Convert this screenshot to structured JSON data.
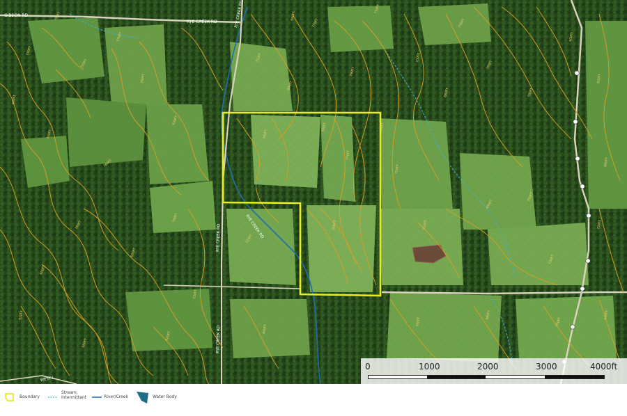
{
  "map": {
    "road_labels": [
      {
        "id": "gibson-rd",
        "text": "GIBSON RD"
      },
      {
        "id": "rye-creek-rd-top",
        "text": "RYE CREEK RD"
      },
      {
        "id": "rye-creek-rd-vertical-n",
        "text": "RYE CREEK RD"
      },
      {
        "id": "rye-creek-rd-vertical-mid",
        "text": "RYE CREEK RD"
      },
      {
        "id": "rye-creek-rd-vertical-s",
        "text": "RYE CREEK RD"
      },
      {
        "id": "rye-creek-rd-diagonal",
        "text": "RYE CREEK RD"
      },
      {
        "id": "west-label",
        "text": "WEST L"
      }
    ],
    "contour_labels": [
      "740FT",
      "720FT",
      "700FT",
      "680FT",
      "760FT",
      "780FT",
      "800FT",
      "820FT",
      "660FT",
      "640FT",
      "750FT",
      "730FT",
      "710FT",
      "690FT",
      "770FT",
      "790FT"
    ],
    "route_markers": 9,
    "colors": {
      "boundary": "#e8ea2a",
      "contour": "#d8a024",
      "stream": "#3fb3cc",
      "river": "#1f6fb0",
      "water_body": "#1c6e8a",
      "road": "#d9d2bd"
    }
  },
  "scale_bar": {
    "ticks": [
      "0",
      "1000",
      "2000",
      "3000",
      "4000ft"
    ]
  },
  "legend": {
    "items": [
      {
        "label": "Boundary",
        "icon": "boundary-icon"
      },
      {
        "label": "Stream, Intermittant",
        "icon": "stream-icon"
      },
      {
        "label": "River/Creek",
        "icon": "river-icon"
      },
      {
        "label": "Water Body",
        "icon": "water-body-icon"
      }
    ]
  }
}
